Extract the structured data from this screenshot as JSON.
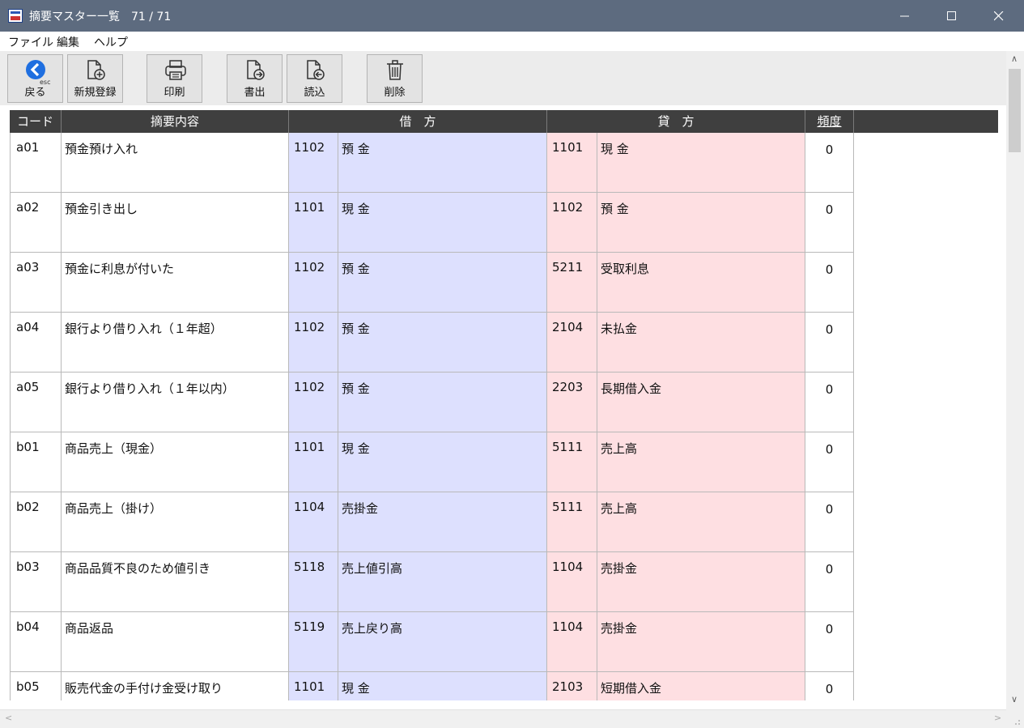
{
  "window": {
    "title": "摘要マスター一覧　71 / 71"
  },
  "menu": [
    "ファイル",
    "編集",
    "ヘルプ"
  ],
  "toolbar": {
    "back": {
      "label": "戻る",
      "hint": "esc"
    },
    "new": "新規登録",
    "print": "印刷",
    "export": "書出",
    "import": "読込",
    "delete": "削除"
  },
  "table": {
    "headers": {
      "code": "コード",
      "desc": "摘要内容",
      "debit": "借　方",
      "credit": "貸　方",
      "freq": "頻度"
    },
    "rows": [
      {
        "code": "a01",
        "desc": "預金預け入れ",
        "debit_code": "1102",
        "debit_name": "預 金",
        "credit_code": "1101",
        "credit_name": "現 金",
        "freq": "0"
      },
      {
        "code": "a02",
        "desc": "預金引き出し",
        "debit_code": "1101",
        "debit_name": "現 金",
        "credit_code": "1102",
        "credit_name": "預 金",
        "freq": "0"
      },
      {
        "code": "a03",
        "desc": "預金に利息が付いた",
        "debit_code": "1102",
        "debit_name": "預 金",
        "credit_code": "5211",
        "credit_name": "受取利息",
        "freq": "0"
      },
      {
        "code": "a04",
        "desc": "銀行より借り入れ（１年超）",
        "debit_code": "1102",
        "debit_name": "預 金",
        "credit_code": "2104",
        "credit_name": "未払金",
        "freq": "0"
      },
      {
        "code": "a05",
        "desc": "銀行より借り入れ（１年以内）",
        "debit_code": "1102",
        "debit_name": "預 金",
        "credit_code": "2203",
        "credit_name": "長期借入金",
        "freq": "0"
      },
      {
        "code": "b01",
        "desc": "商品売上（現金）",
        "debit_code": "1101",
        "debit_name": "現 金",
        "credit_code": "5111",
        "credit_name": "売上高",
        "freq": "0"
      },
      {
        "code": "b02",
        "desc": "商品売上（掛け）",
        "debit_code": "1104",
        "debit_name": "売掛金",
        "credit_code": "5111",
        "credit_name": "売上高",
        "freq": "0"
      },
      {
        "code": "b03",
        "desc": "商品品質不良のため値引き",
        "debit_code": "5118",
        "debit_name": "売上値引高",
        "credit_code": "1104",
        "credit_name": "売掛金",
        "freq": "0"
      },
      {
        "code": "b04",
        "desc": "商品返品",
        "debit_code": "5119",
        "debit_name": "売上戻り高",
        "credit_code": "1104",
        "credit_name": "売掛金",
        "freq": "0"
      },
      {
        "code": "b05",
        "desc": "販売代金の手付け金受け取り",
        "debit_code": "1101",
        "debit_name": "現 金",
        "credit_code": "2103",
        "credit_name": "短期借入金",
        "freq": "0"
      }
    ]
  },
  "colors": {
    "titlebar": "#5d6b7f",
    "debit_bg": "#dde0fe",
    "credit_bg": "#fedfe2",
    "header_bg": "#3f3f3f",
    "back_icon": "#1f6fe0"
  }
}
